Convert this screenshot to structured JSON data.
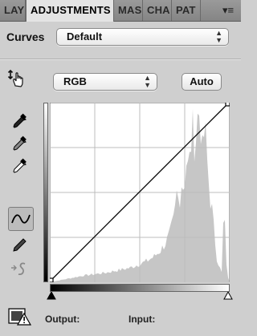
{
  "tabs": [
    {
      "label": "LAY",
      "active": false
    },
    {
      "label": "ADJUSTMENTS",
      "active": true
    },
    {
      "label": "MAS",
      "active": false
    },
    {
      "label": "CHA",
      "active": false
    },
    {
      "label": "PAT",
      "active": false
    }
  ],
  "panel": {
    "title": "Curves",
    "preset_select": {
      "value": "Default"
    },
    "channel_select": {
      "value": "RGB"
    },
    "auto_button": "Auto"
  },
  "tools": [
    {
      "name": "on-image-adjust-icon",
      "selected": false
    },
    {
      "name": "black-point-eyedropper-icon",
      "selected": false
    },
    {
      "name": "gray-point-eyedropper-icon",
      "selected": false
    },
    {
      "name": "white-point-eyedropper-icon",
      "selected": false
    },
    {
      "name": "curve-point-tool-icon",
      "selected": true
    },
    {
      "name": "pencil-tool-icon",
      "selected": false
    },
    {
      "name": "smooth-curve-icon",
      "selected": false
    }
  ],
  "curve": {
    "points": [
      [
        0,
        0
      ],
      [
        255,
        255
      ]
    ]
  },
  "footer": {
    "output_label": "Output:",
    "input_label": "Input:"
  },
  "colors": {
    "panel_bg": "#cfcfcf",
    "graph_bg": "#ffffff",
    "histogram": "#c8c8c8",
    "grid": "#b9b9b9"
  }
}
